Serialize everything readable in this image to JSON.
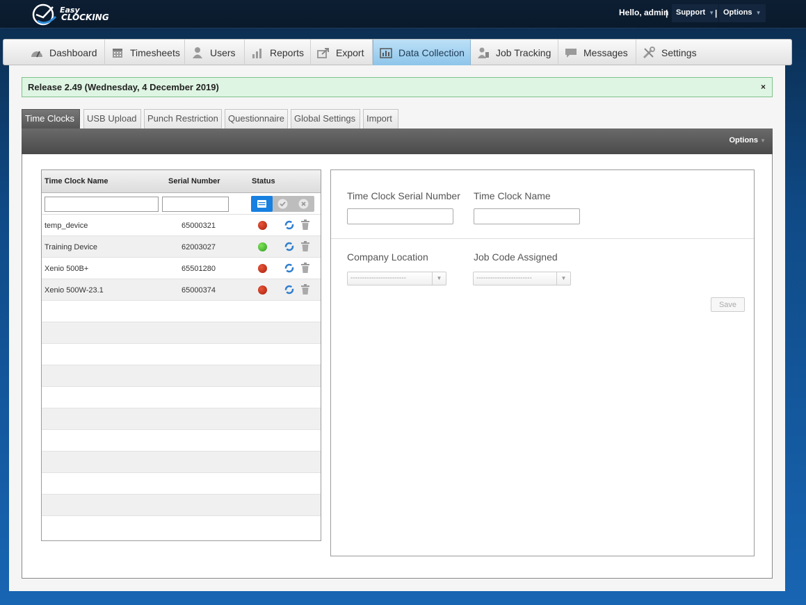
{
  "header": {
    "brand": "EASY CLOCKING",
    "greeting": "Hello, admin",
    "separator": "|",
    "support_label": "Support",
    "options_label": "Options"
  },
  "nav": [
    {
      "label": "Dashboard",
      "icon": "speedometer-icon"
    },
    {
      "label": "Timesheets",
      "icon": "calendar-icon"
    },
    {
      "label": "Users",
      "icon": "user-icon"
    },
    {
      "label": "Reports",
      "icon": "bar-chart-icon"
    },
    {
      "label": "Export",
      "icon": "export-icon"
    },
    {
      "label": "Data Collection",
      "icon": "data-collection-icon",
      "active": true
    },
    {
      "label": "Job Tracking",
      "icon": "job-tracking-icon"
    },
    {
      "label": "Messages",
      "icon": "message-icon"
    },
    {
      "label": "Settings",
      "icon": "wrench-icon"
    }
  ],
  "release": {
    "text": "Release 2.49 (Wednesday, 4 December 2019)",
    "close": "×"
  },
  "tabs": [
    {
      "label": "Time Clocks",
      "active": true
    },
    {
      "label": "USB Upload"
    },
    {
      "label": "Punch Restriction"
    },
    {
      "label": "Questionnaire"
    },
    {
      "label": "Global Settings"
    },
    {
      "label": "Import"
    }
  ],
  "toolbar": {
    "options_label": "Options"
  },
  "grid": {
    "columns": {
      "name": "Time Clock Name",
      "serial": "Serial Number",
      "status": "Status"
    },
    "rows": [
      {
        "name": "temp_device",
        "serial": "65000321",
        "status": "offline"
      },
      {
        "name": "Training Device",
        "serial": "62003027",
        "status": "online"
      },
      {
        "name": "Xenio 500B+",
        "serial": "65501280",
        "status": "offline"
      },
      {
        "name": "Xenio 500W-23.1",
        "serial": "65000374",
        "status": "offline"
      }
    ]
  },
  "form": {
    "serial_label": "Time Clock Serial Number",
    "name_label": "Time Clock Name",
    "location_label": "Company Location",
    "jobcode_label": "Job Code Assigned",
    "location_value": "------------------------",
    "jobcode_value": "------------------------",
    "save_label": "Save"
  },
  "colors": {
    "accent": "#1780e0",
    "status_offline": "#c0280f",
    "status_online": "#45b82a",
    "release_bg": "#dff5e3"
  }
}
